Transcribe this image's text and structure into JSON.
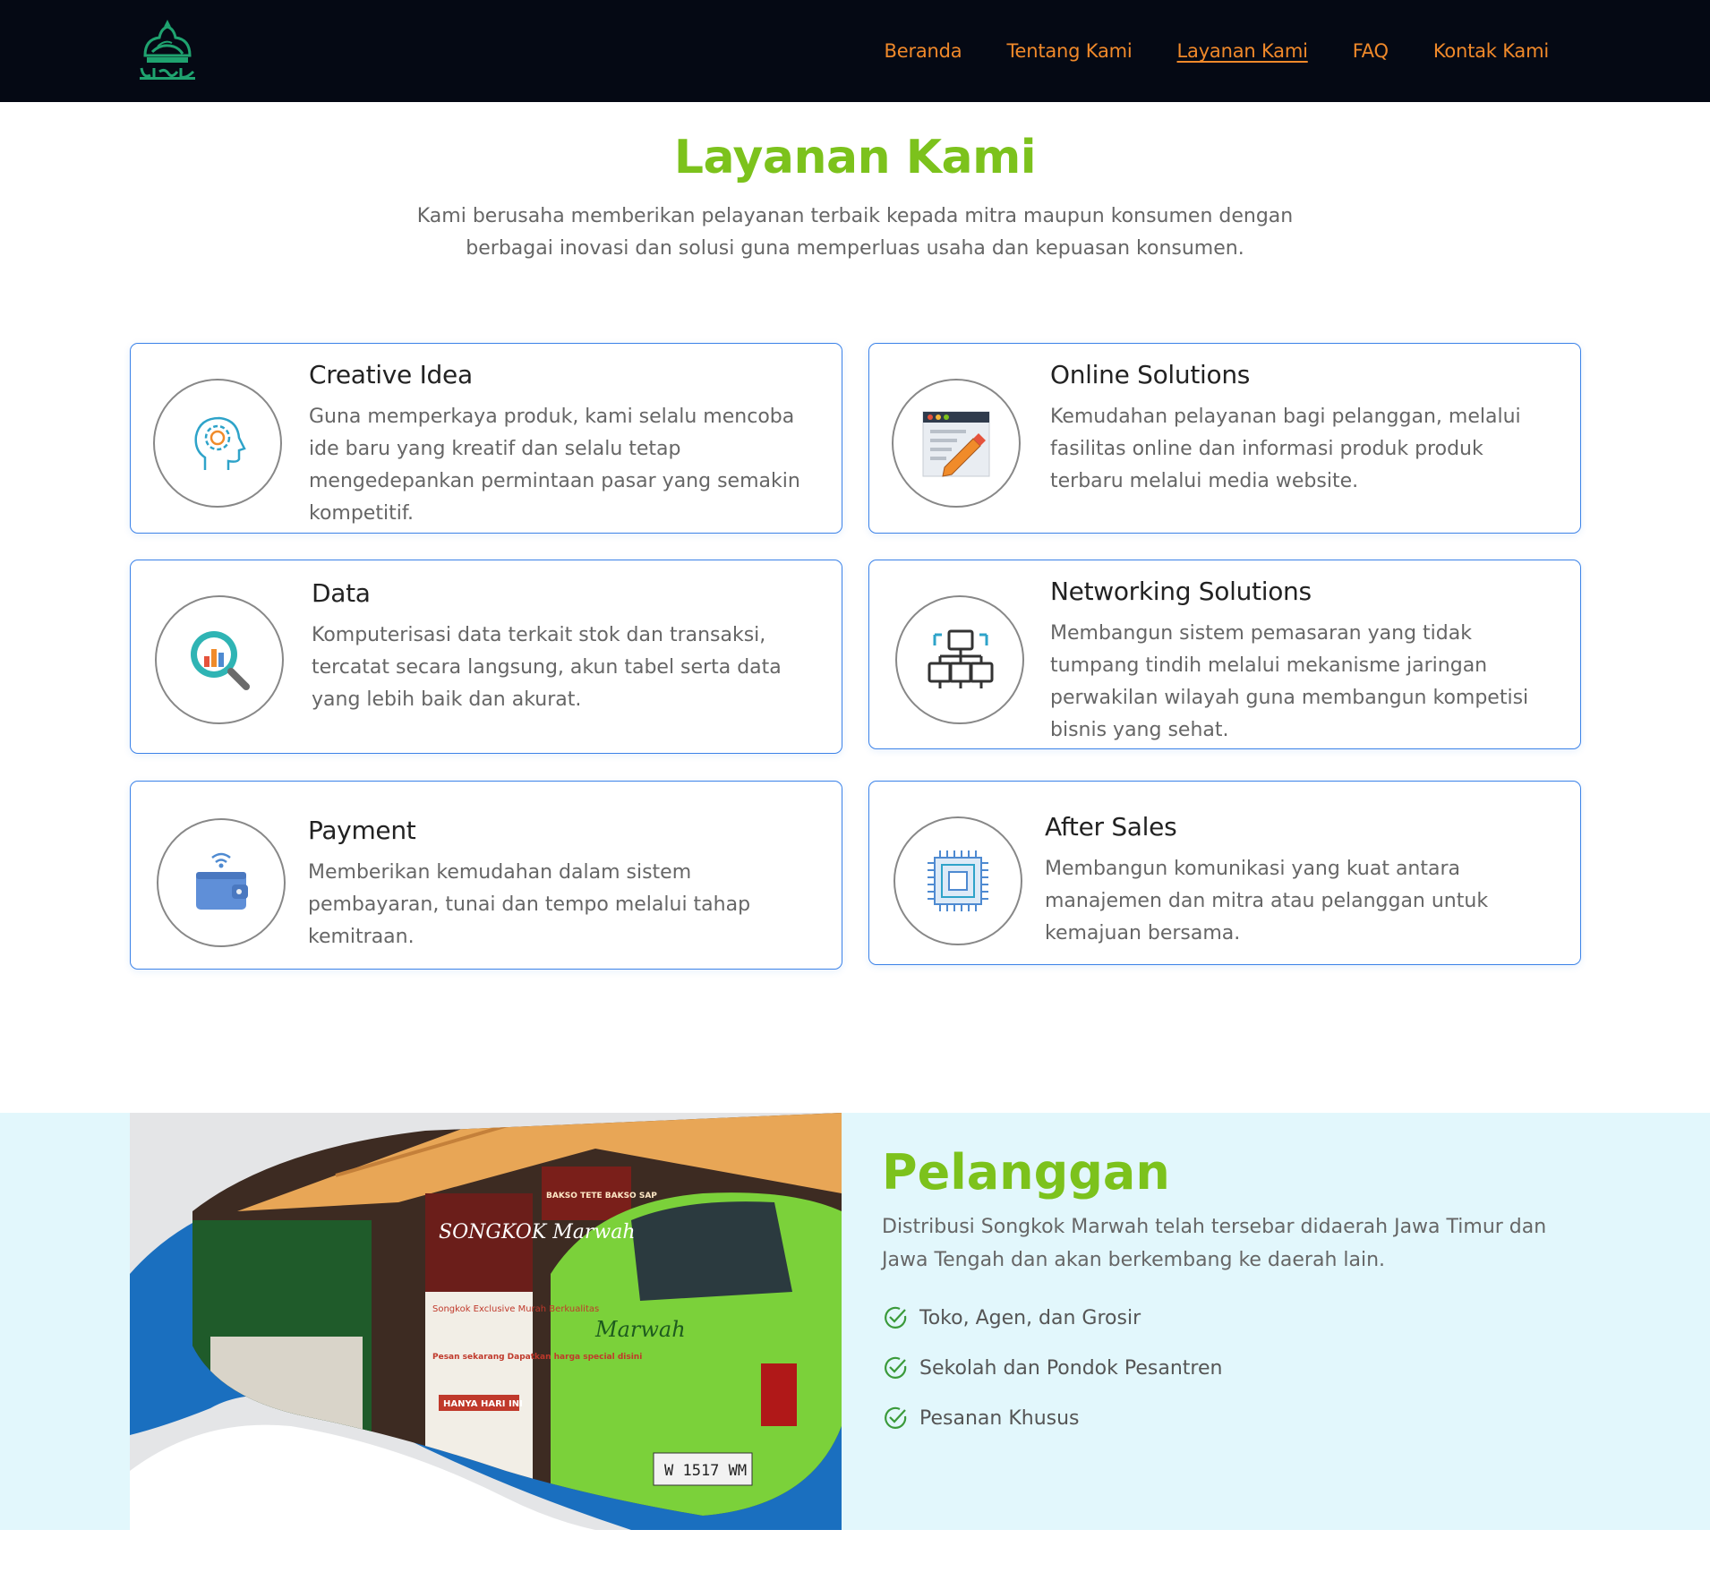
{
  "header": {
    "logo_name": "Songkok Marwah",
    "nav": [
      {
        "label": "Beranda",
        "active": false
      },
      {
        "label": "Tentang Kami",
        "active": false
      },
      {
        "label": "Layanan Kami",
        "active": true
      },
      {
        "label": "FAQ",
        "active": false
      },
      {
        "label": "Kontak Kami",
        "active": false
      }
    ],
    "nav_color": "#f0892a"
  },
  "services": {
    "title": "Layanan Kami",
    "description": "Kami berusaha memberikan pelayanan terbaik kepada mitra maupun konsumen dengan berbagai inovasi dan solusi guna memperluas usaha dan kepuasan konsumen.",
    "items": [
      {
        "icon": "creative-head-icon",
        "title": "Creative Idea",
        "text": "Guna memperkaya produk, kami selalu mencoba ide baru yang kreatif dan selalu tetap mengedepankan permintaan pasar yang semakin kompetitif."
      },
      {
        "icon": "online-browser-icon",
        "title": "Online Solutions",
        "text": "Kemudahan pelayanan bagi pelanggan, melalui fasilitas online dan informasi produk produk terbaru melalui media website."
      },
      {
        "icon": "data-magnifier-icon",
        "title": "Data",
        "text": "Komputerisasi data terkait stok dan transaksi, tercatat secara langsung, akun tabel serta data yang lebih baik dan akurat."
      },
      {
        "icon": "network-icon",
        "title": "Networking Solutions",
        "text": "Membangun sistem pemasaran yang tidak tumpang tindih melalui mekanisme jaringan perwakilan wilayah guna membangun kompetisi bisnis yang sehat."
      },
      {
        "icon": "wallet-icon",
        "title": "Payment",
        "text": "Memberikan kemudahan dalam sistem pembayaran, tunai dan tempo melalui tahap kemitraan."
      },
      {
        "icon": "chip-icon",
        "title": "After Sales",
        "text": "Membangun komunikasi yang kuat antara manajemen dan mitra atau pelanggan untuk kemajuan bersama."
      }
    ]
  },
  "customers": {
    "title": "Pelanggan",
    "description": "Distribusi Songkok Marwah telah tersebar didaerah Jawa Timur dan Jawa Tengah dan akan berkembang ke daerah lain.",
    "list": [
      "Toko, Agen, dan Grosir",
      "Sekolah dan Pondok Pesantren",
      "Pesanan Khusus"
    ],
    "photo": {
      "sign_brand": "SONGKOK Marwah",
      "sign_sub": "Songkok Exclusive Murah Berkualitas",
      "sign_promo": "Pesan sekarang Dapatkan harga special disini",
      "sign_badge": "HANYA HARI INI",
      "plate": "W 1517 WM",
      "car_brand": "Marwah",
      "banner": "BAKSO TETE BAKSO SAP"
    }
  },
  "colors": {
    "accent_green": "#7cc21c",
    "card_border": "#3b82e8",
    "band": "#e2f7fc",
    "header_bg": "#050914"
  }
}
